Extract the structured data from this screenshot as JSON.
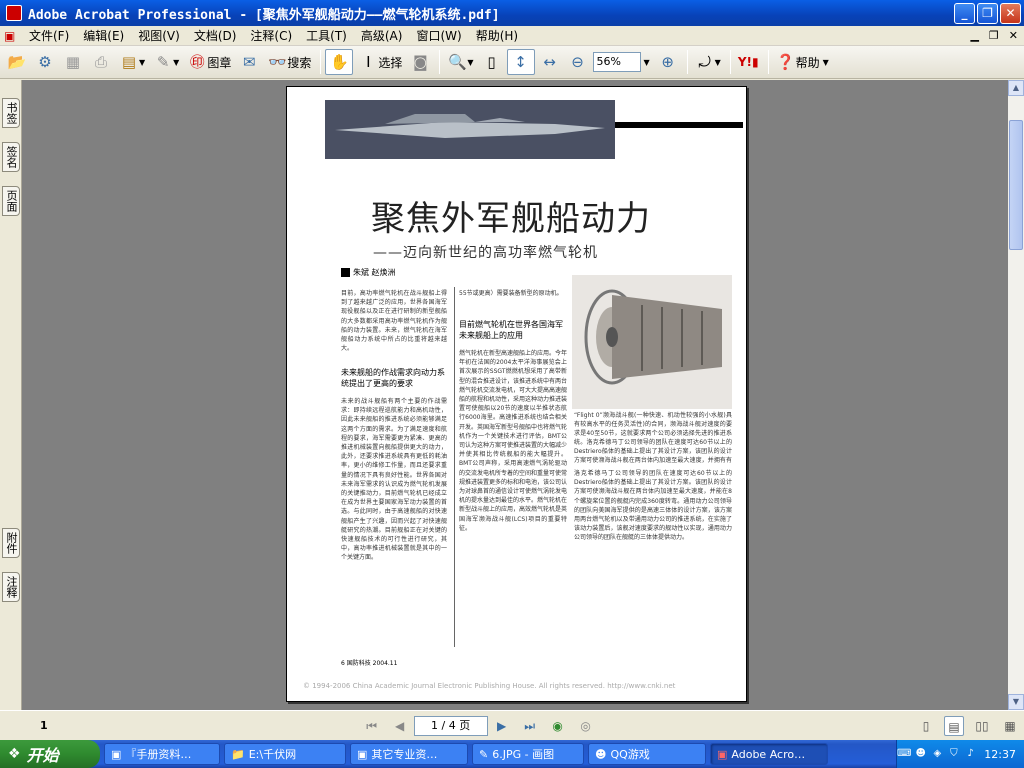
{
  "window": {
    "title": "Adobe Acrobat Professional - [聚焦外军舰船动力——燃气轮机系统.pdf]",
    "minimize": "_",
    "maximize": "❐",
    "close": "✕"
  },
  "menu": [
    "文件(F)",
    "编辑(E)",
    "视图(V)",
    "文档(D)",
    "注释(C)",
    "工具(T)",
    "高级(A)",
    "窗口(W)",
    "帮助(H)"
  ],
  "toolbar": {
    "stamp": "图章",
    "search": "搜索",
    "select": "选择",
    "zoom": "56%",
    "help": "帮助"
  },
  "sidetabs": {
    "bookmarks": "书签",
    "signatures": "签名",
    "pages": "页面",
    "attachments": "附件",
    "comments": "注释"
  },
  "status": {
    "page": "1 / 4 页",
    "size_label": "1"
  },
  "article": {
    "title": "聚焦外军舰船动力",
    "subtitle": "——迈向新世纪的高功率燃气轮机",
    "authors": "朱斌  赵焕洲",
    "col1a": "目前，高功率燃气轮机在战斗舰船上得到了越来越广泛的应用，世界各国海军现役舰船以及正在进行研制的新型舰船的大多数都采用高功率燃气轮机作为舰船的动力装置。未来，燃气轮机在海军舰船动力系统中所占的比重将越来越大。",
    "head1": "未来舰船的作战需求向动力系统提出了更高的要求",
    "col1b": "未来的战斗舰船有两个主要的作战需求：即持续远程巡航能力和高机动性，因此未来舰船的推进系统必须能够满足这两个方面的需求。为了满足速度和航程的要求，海军需要更为紧凑、更高的推进机械装置向舰船提供更大的动力，此外，还要求推进系统具有更低的耗油率，更小的维修工作量，而且还要求重量的情况下具有良好性能。世界各国对未来海军需求的认识成为燃气轮机发展的关键推动力，目前燃气轮机已经成立在成为世界主要国家海军动力装置的首选。与此同时，由于高速舰船的对快速舰船产生了兴趣，因而兴起了对快速舰艇研究的热潮。目前舰船正在对关键的快速舰船技术的可行性进行研究，其中，高功率推进机械装置就是其中的一个关键方面。",
    "col2a": "55节或更高）需要装备新型的原动机。",
    "head2": "目前燃气轮机在世界各国海军未来舰船上的应用",
    "col2b": "燃气轮机在新型高速舰船上的应用。今年年初在法国的2004太平洋海事展览会上首次展示的SSGT燃燃机想采用了高带新型的混合推进设计，该推进系统中有两台燃气轮机交流发电机，可大大提高高速舰船的航程和机动性，采用这种动力推进装置可使舰船以20节的速度以半推状态航行6000海里。高速推进系统也结合相关开发。英国海军新型号舰船中也将燃气轮机作为一个关键技术进行评估，BMT公司认为这种方案可使推进装置的大幅减少并使其相比传统舰船的能大幅提升。BMT公司声称，采用高速燃气涡轮驱动的交流发电机所专着的空间和重量可使常规推进装置更多的标和和电池，该公司认为对球鼻首的通信设计可使燃气涡轮发电机的提水量达到最佳的水平。燃气轮机在新型战斗舰上的应用，高效燃气轮机是英国海军濒海战斗舰(LCS)项目的重要特征。",
    "caption": "“Flight 0”濒海战斗舰(一种快速、机动性较强的小水舰)具有较高水平的任务灵活性)的合同，濒海战斗舰对速度的要求是40至50节，这就要求两个公司必须选择先进的推进系统。洛克希德马丁公司领导的团队在速度可达60节以上的Destriero船体的基础上提出了其设计方案，该团队的设计方案可使濒海战斗舰在两台体内加速至最大速度，并拥有有4个螺旋桨体水喷流器推进系统。",
    "col3b": "洛克希德马丁公司领导的团队在速度可达60节以上的Destriero船体的基础上提出了其设计方案。该团队的设计方案可使濒海战斗舰在两台体内加速至最大速度，并能在8个螺旋桨位置的舰艇内完成360度转弯。通用动力公司领导的团队向美国海军提供的是高速三体体的设计方案，该方案用两台燃气轮机以及带通用动力公司的推进系统，在实施了该动力装置后，该舰对速度要求的舰动性以实现，通用动力公司领导的团队在舰艇的三体体提供动力。",
    "pagenum": "6  国防科技 2004.11",
    "footer": "© 1994-2006 China Academic Journal Electronic Publishing House. All rights reserved.    http://www.cnki.net"
  },
  "taskbar": {
    "start": "开始",
    "items": [
      "『手册资料…",
      "E:\\千伏网",
      "其它专业资…",
      "6.JPG - 画图",
      "QQ游戏",
      "Adobe Acro…"
    ],
    "clock": "12:37"
  }
}
